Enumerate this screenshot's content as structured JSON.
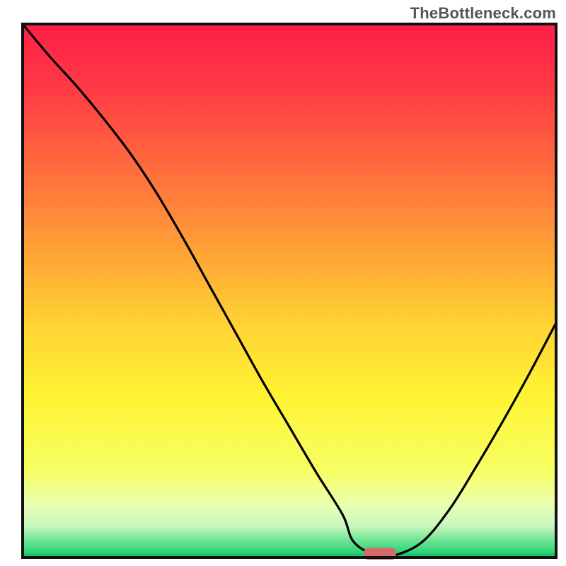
{
  "watermark": "TheBottleneck.com",
  "chart_data": {
    "type": "line",
    "title": "",
    "xlabel": "",
    "ylabel": "",
    "xlim": [
      0,
      100
    ],
    "ylim": [
      0,
      100
    ],
    "grid": false,
    "series": [
      {
        "name": "bottleneck-curve",
        "x": [
          0,
          5,
          10,
          15,
          20,
          25,
          30,
          35,
          40,
          45,
          50,
          55,
          60,
          62,
          66,
          70,
          75,
          80,
          85,
          90,
          95,
          100
        ],
        "y": [
          100,
          94,
          88.5,
          82.5,
          76,
          68.5,
          60,
          51,
          42,
          33,
          24.5,
          16,
          8,
          3,
          0.5,
          0.5,
          3,
          9,
          17,
          25.5,
          34.5,
          44
        ]
      }
    ],
    "marker": {
      "name": "highlight-pill",
      "x": 67,
      "y": 0.7,
      "width": 6,
      "height": 2.2,
      "color": "#d46a6a"
    },
    "gradient_stops": [
      {
        "offset": 0.0,
        "color": "#ff1f47"
      },
      {
        "offset": 0.12,
        "color": "#ff3a45"
      },
      {
        "offset": 0.28,
        "color": "#ff6f3d"
      },
      {
        "offset": 0.42,
        "color": "#ffa036"
      },
      {
        "offset": 0.56,
        "color": "#ffd233"
      },
      {
        "offset": 0.7,
        "color": "#fff433"
      },
      {
        "offset": 0.84,
        "color": "#f6ff66"
      },
      {
        "offset": 0.9,
        "color": "#eaffb0"
      },
      {
        "offset": 0.94,
        "color": "#c9f7c0"
      },
      {
        "offset": 0.975,
        "color": "#58e08b"
      },
      {
        "offset": 1.0,
        "color": "#18c96b"
      }
    ],
    "frame": {
      "inner_left": 32,
      "inner_top": 34,
      "inner_right": 786,
      "inner_bottom": 788,
      "stroke": "#111",
      "stroke_width": 4
    }
  }
}
